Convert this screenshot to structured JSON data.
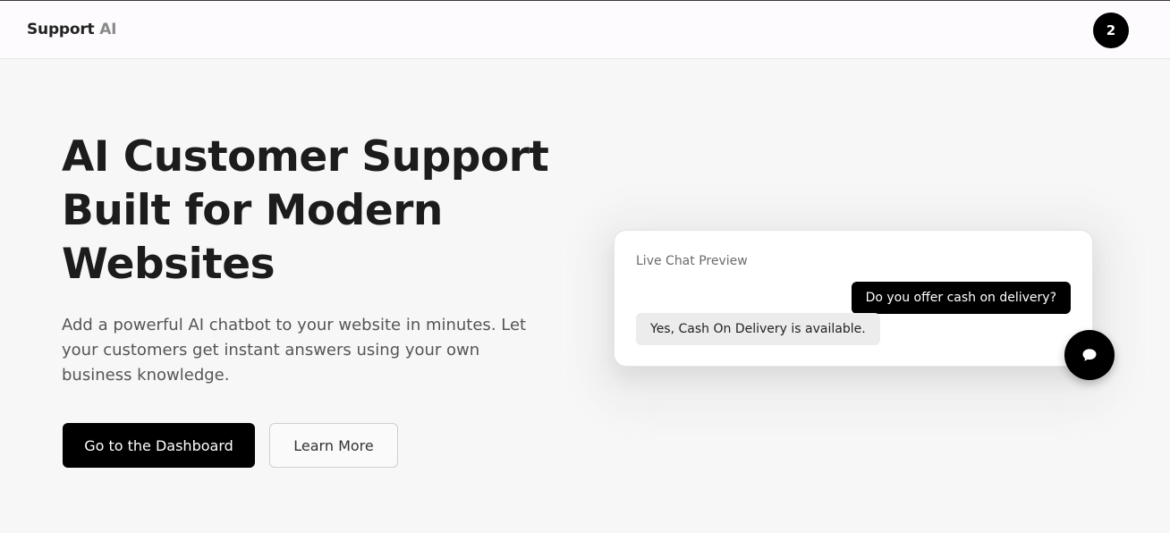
{
  "header": {
    "brand_main": "Support",
    "brand_accent": "AI",
    "avatar_label": "2"
  },
  "hero": {
    "title": "AI Customer Support Built for Modern Websites",
    "subtitle": "Add a powerful AI chatbot to your website in minutes. Let your customers get instant answers using your own business knowledge.",
    "primary_button": "Go to the Dashboard",
    "secondary_button": "Learn More"
  },
  "chat_preview": {
    "heading": "Live Chat Preview",
    "user_message": "Do you offer cash on delivery?",
    "bot_message": "Yes, Cash On Delivery is available.",
    "fab_icon": "chat-bubble-icon"
  },
  "colors": {
    "background": "#f7f7f7",
    "primary": "#000000",
    "text": "#1c1c1c",
    "muted": "#8a8a8a"
  }
}
